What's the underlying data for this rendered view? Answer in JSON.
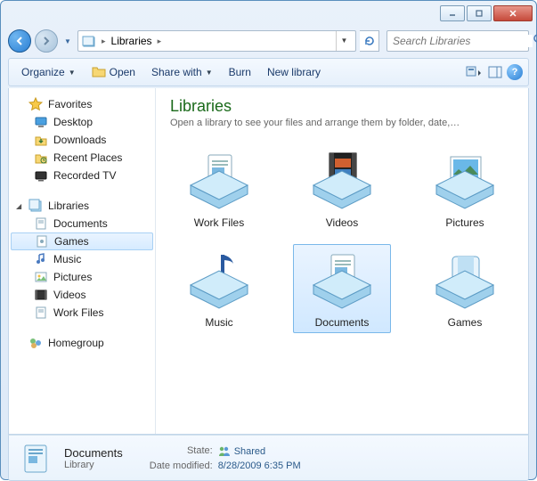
{
  "breadcrumb": {
    "root": "Libraries"
  },
  "search": {
    "placeholder": "Search Libraries"
  },
  "toolbar": {
    "organize": "Organize",
    "open": "Open",
    "share": "Share with",
    "burn": "Burn",
    "newlib": "New library"
  },
  "sidebar": {
    "favorites": {
      "label": "Favorites",
      "items": [
        "Desktop",
        "Downloads",
        "Recent Places",
        "Recorded TV"
      ]
    },
    "libraries": {
      "label": "Libraries",
      "items": [
        "Documents",
        "Games",
        "Music",
        "Pictures",
        "Videos",
        "Work Files"
      ],
      "selected": "Games"
    },
    "homegroup": {
      "label": "Homegroup"
    }
  },
  "content": {
    "title": "Libraries",
    "subtitle": "Open a library to see your files and arrange them by folder, date,…",
    "items": [
      {
        "name": "Work Files",
        "kind": "doc"
      },
      {
        "name": "Videos",
        "kind": "video"
      },
      {
        "name": "Pictures",
        "kind": "picture"
      },
      {
        "name": "Music",
        "kind": "music"
      },
      {
        "name": "Documents",
        "kind": "doc",
        "selected": true
      },
      {
        "name": "Games",
        "kind": "game"
      }
    ]
  },
  "details": {
    "name": "Documents",
    "type": "Library",
    "state_label": "State:",
    "state_value": "Shared",
    "modified_label": "Date modified:",
    "modified_value": "8/28/2009 6:35 PM"
  }
}
